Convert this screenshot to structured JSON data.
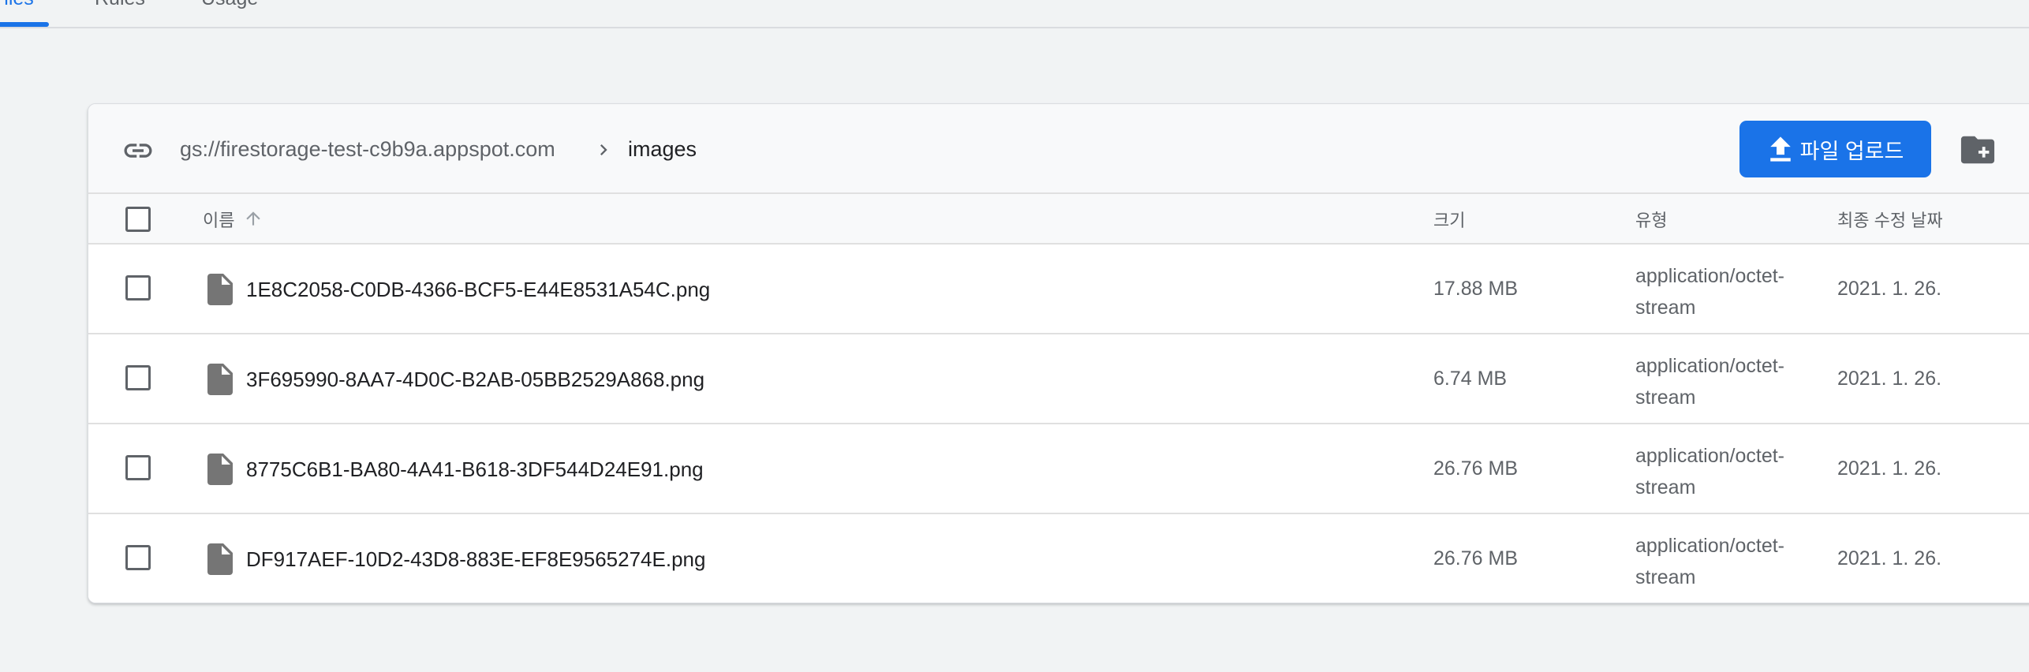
{
  "tabs": [
    {
      "label": "Files",
      "active": true
    },
    {
      "label": "Rules",
      "active": false
    },
    {
      "label": "Usage",
      "active": false
    }
  ],
  "toolbar": {
    "bucket_path": "gs://firestorage-test-c9b9a.appspot.com",
    "current_folder": "images",
    "upload_label": "파일 업로드"
  },
  "table": {
    "headers": {
      "name": "이름",
      "size": "크기",
      "type": "유형",
      "modified": "최종 수정 날짜"
    },
    "rows": [
      {
        "name": "1E8C2058-C0DB-4366-BCF5-E44E8531A54C.png",
        "size": "17.88 MB",
        "type": "application/octet-stream",
        "modified": "2021. 1. 26."
      },
      {
        "name": "3F695990-8AA7-4D0C-B2AB-05BB2529A868.png",
        "size": "6.74 MB",
        "type": "application/octet-stream",
        "modified": "2021. 1. 26."
      },
      {
        "name": "8775C6B1-BA80-4A41-B618-3DF544D24E91.png",
        "size": "26.76 MB",
        "type": "application/octet-stream",
        "modified": "2021. 1. 26."
      },
      {
        "name": "DF917AEF-10D2-43D8-883E-EF8E9565274E.png",
        "size": "26.76 MB",
        "type": "application/octet-stream",
        "modified": "2021. 1. 26."
      }
    ]
  },
  "colors": {
    "accent": "#1a73e8",
    "background": "#f1f3f4",
    "icon_gray": "#757575"
  },
  "icons": {
    "link": "link-icon",
    "breadcrumb_separator": "chevron-right-icon",
    "upload": "upload-icon",
    "new_folder": "create-new-folder-icon",
    "sort": "arrow-up-icon",
    "file": "file-icon"
  }
}
